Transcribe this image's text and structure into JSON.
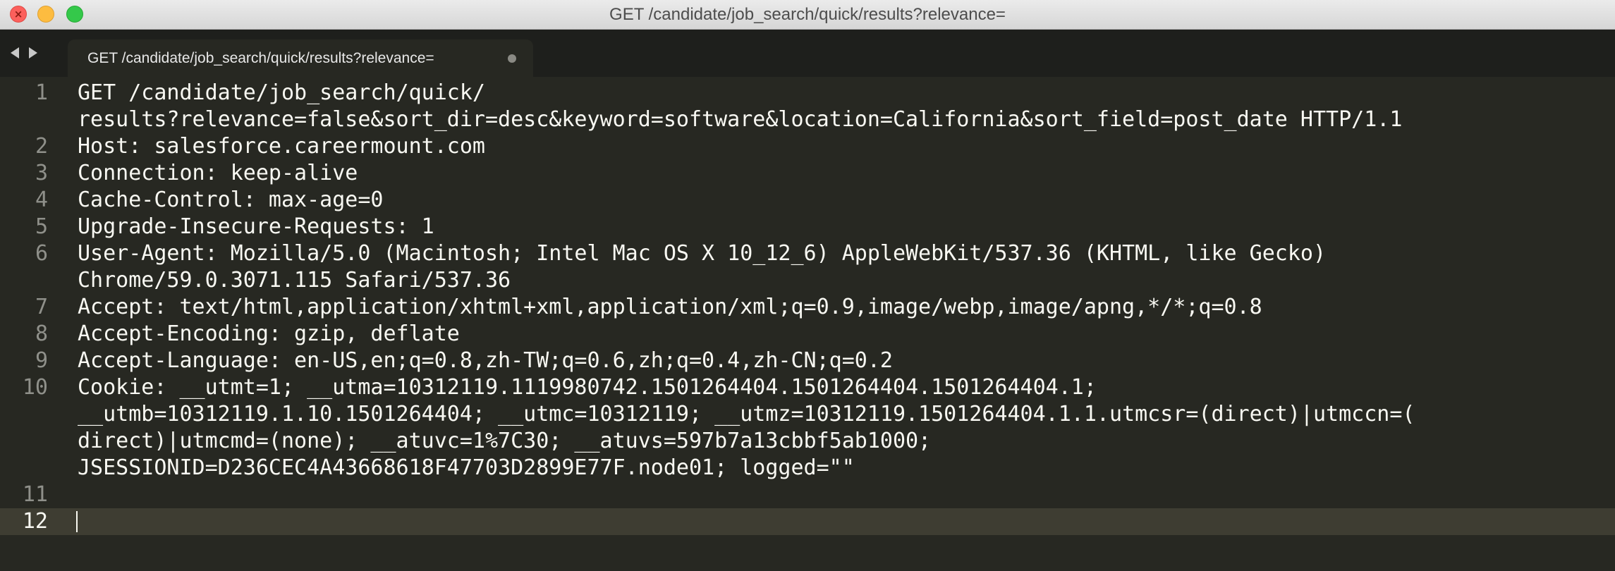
{
  "window": {
    "title": "GET /candidate/job_search/quick/results?relevance="
  },
  "tab": {
    "label": "GET /candidate/job_search/quick/results?relevance=",
    "modified": true
  },
  "icons": {
    "close": "close-icon",
    "minimize": "minimize-icon",
    "zoom": "zoom-icon",
    "back": "chevron-left-icon",
    "forward": "chevron-right-icon",
    "dirty": "unsaved-dot-icon"
  },
  "colors": {
    "background": "#272822",
    "foreground": "#f8f8f2",
    "gutter": "#8f908a",
    "current_line": "#3e3d32"
  },
  "editor": {
    "current_line": 12,
    "lines": [
      {
        "num": "1",
        "text": [
          "GET /candidate/job_search/quick/",
          "results?relevance=false&sort_dir=desc&keyword=software&location=California&sort_field=post_date HTTP/1.1"
        ]
      },
      {
        "num": "2",
        "text": [
          "Host: salesforce.careermount.com"
        ]
      },
      {
        "num": "3",
        "text": [
          "Connection: keep-alive"
        ]
      },
      {
        "num": "4",
        "text": [
          "Cache-Control: max-age=0"
        ]
      },
      {
        "num": "5",
        "text": [
          "Upgrade-Insecure-Requests: 1"
        ]
      },
      {
        "num": "6",
        "text": [
          "User-Agent: Mozilla/5.0 (Macintosh; Intel Mac OS X 10_12_6) AppleWebKit/537.36 (KHTML, like Gecko)",
          "Chrome/59.0.3071.115 Safari/537.36"
        ]
      },
      {
        "num": "7",
        "text": [
          "Accept: text/html,application/xhtml+xml,application/xml;q=0.9,image/webp,image/apng,*/*;q=0.8"
        ]
      },
      {
        "num": "8",
        "text": [
          "Accept-Encoding: gzip, deflate"
        ]
      },
      {
        "num": "9",
        "text": [
          "Accept-Language: en-US,en;q=0.8,zh-TW;q=0.6,zh;q=0.4,zh-CN;q=0.2"
        ]
      },
      {
        "num": "10",
        "text": [
          "Cookie: __utmt=1; __utma=10312119.1119980742.1501264404.1501264404.1501264404.1;",
          "__utmb=10312119.1.10.1501264404; __utmc=10312119; __utmz=10312119.1501264404.1.1.utmcsr=(direct)|utmccn=(",
          "direct)|utmcmd=(none); __atuvc=1%7C30; __atuvs=597b7a13cbbf5ab1000;",
          "JSESSIONID=D236CEC4A43668618F47703D2899E77F.node01; logged=\"\""
        ]
      },
      {
        "num": "11",
        "text": [
          ""
        ]
      },
      {
        "num": "12",
        "text": [
          ""
        ]
      }
    ]
  }
}
